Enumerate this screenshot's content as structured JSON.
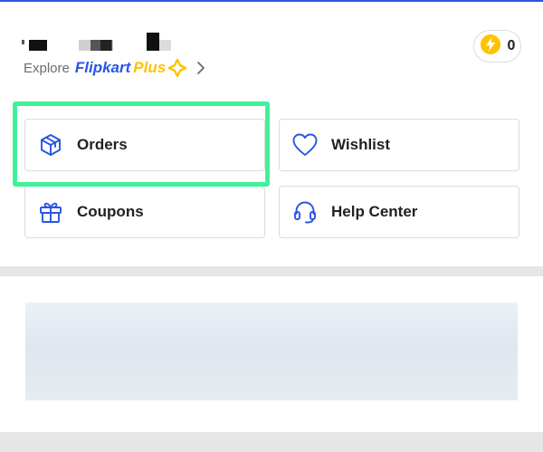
{
  "header": {
    "explore_label": "Explore",
    "brand_name": "Flipkart",
    "plus_label": "Plus",
    "coin_count": "0"
  },
  "tiles": [
    {
      "label": "Orders",
      "icon": "package-icon"
    },
    {
      "label": "Wishlist",
      "icon": "heart-icon"
    },
    {
      "label": "Coupons",
      "icon": "gift-icon"
    },
    {
      "label": "Help Center",
      "icon": "headset-icon"
    }
  ],
  "colors": {
    "brand_blue": "#2a55e5",
    "plus_yellow": "#ffc200",
    "highlight_green": "#3ff299",
    "separator_gray": "#e6e6e6"
  }
}
